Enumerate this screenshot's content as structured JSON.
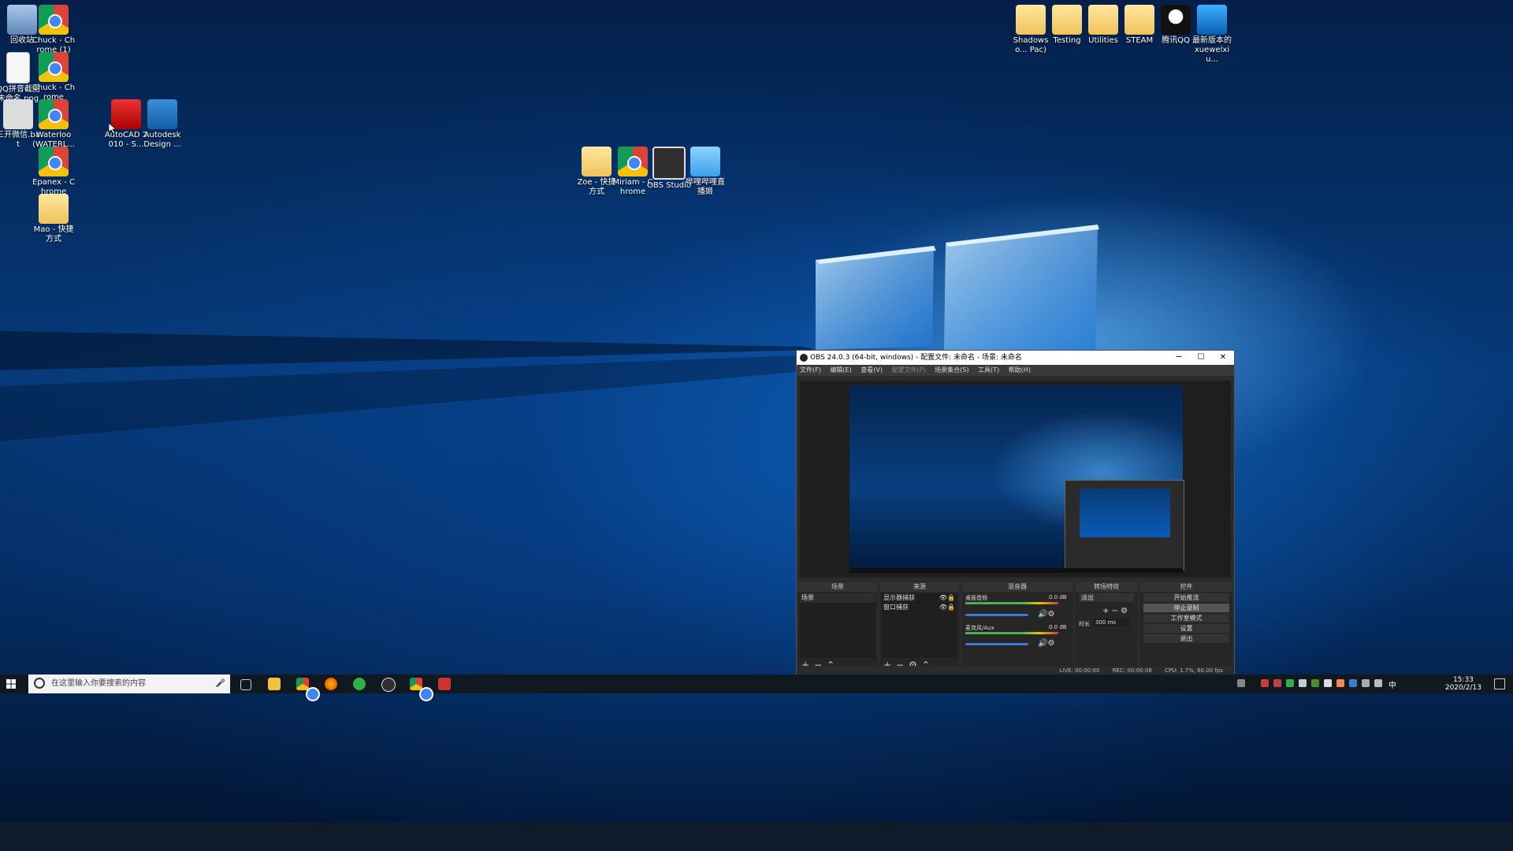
{
  "desktop": {
    "icons": [
      {
        "label": "回收站"
      },
      {
        "label": "Chuck - Chrome (1)"
      },
      {
        "label": "QQ拼音截图未命名.png"
      },
      {
        "label": "Chuck - Chrome"
      },
      {
        "label": "三开微信.bat"
      },
      {
        "label": "Waterloo (WATERL..."
      },
      {
        "label": "AutoCAD 2010 - S..."
      },
      {
        "label": "Autodesk Design ..."
      },
      {
        "label": "Epanex - Chrome"
      },
      {
        "label": "Mao - 快捷方式"
      },
      {
        "label": "Zoe - 快捷方式"
      },
      {
        "label": "Miriam - Chrome"
      },
      {
        "label": "OBS Studio"
      },
      {
        "label": "哔哩哔哩直播姬"
      },
      {
        "label": "Shadowso... Pac)"
      },
      {
        "label": "Testing"
      },
      {
        "label": "Utilities"
      },
      {
        "label": "STEAM"
      },
      {
        "label": "腾讯QQ"
      },
      {
        "label": "最新版本的 xuewelxiu..."
      }
    ]
  },
  "obs": {
    "title": "OBS 24.0.3 (64-bit, windows) - 配置文件: 未命名 - 场景: 未命名",
    "menu": [
      "文件(F)",
      "编辑(E)",
      "查看(V)",
      "配置文件(P)",
      "场景集合(S)",
      "工具(T)",
      "帮助(H)"
    ],
    "window_buttons": {
      "minimize": "─",
      "maximize": "☐",
      "close": "✕"
    },
    "docks": {
      "scenes": {
        "title": "场景",
        "items": [
          "场景"
        ]
      },
      "sources": {
        "title": "来源",
        "items": [
          "显示器捕获",
          "窗口捕获"
        ]
      },
      "mixer": {
        "title": "混音器",
        "channels": [
          {
            "name": "桌面音频",
            "db": "0.0 dB"
          },
          {
            "name": "麦克风/Aux",
            "db": "0.0 dB"
          }
        ]
      },
      "transitions": {
        "title": "转场特效",
        "transition": "淡出",
        "duration_label": "时长",
        "duration": "300 ms"
      },
      "controls": {
        "title": "控件",
        "buttons": [
          "开始推流",
          "停止录制",
          "工作室模式",
          "设置",
          "退出"
        ]
      }
    },
    "status": {
      "live": "LIVE: 00:00:00",
      "rec": "REC: 00:00:08",
      "cpu": "CPU: 1.7%, 60.00 fps"
    }
  },
  "taskbar": {
    "search_placeholder": "在这里输入你要搜索的内容",
    "time": "15:33",
    "date": "2020/2/13",
    "ime": "中"
  }
}
